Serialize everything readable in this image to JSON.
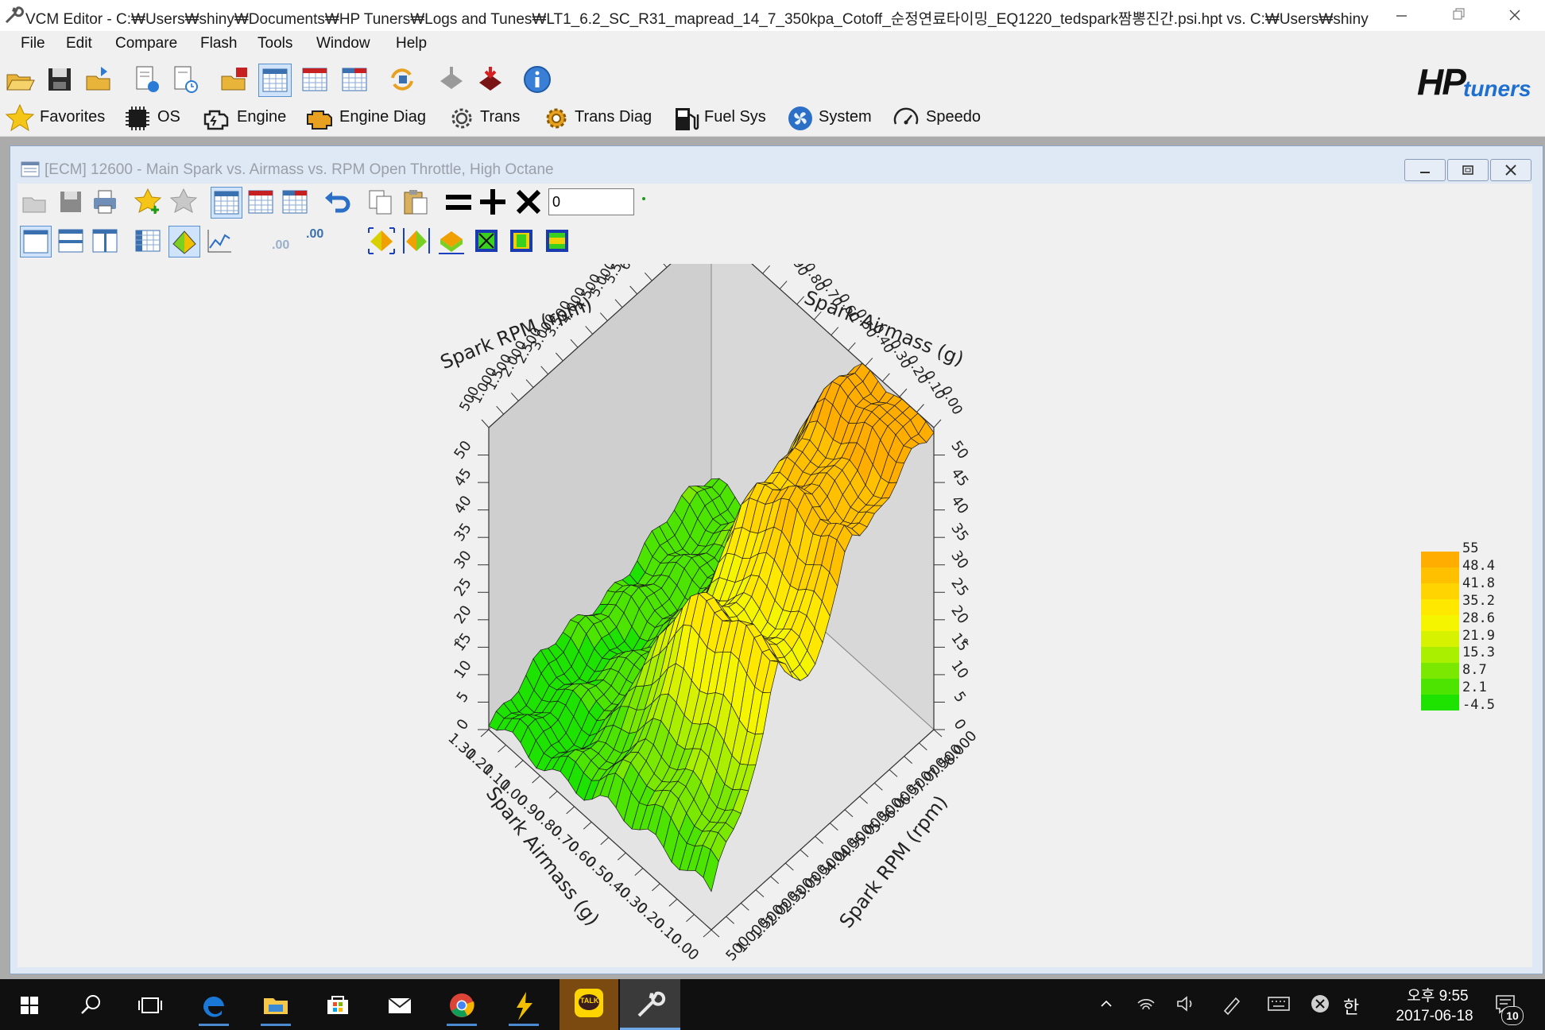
{
  "window": {
    "title": "VCM Editor - C:₩Users₩shiny₩Documents₩HP Tuners₩Logs and Tunes₩LT1_6.2_SC_R31_mapread_14_7_350kpa_Cotoff_순정연료타이밍_EQ1220_tedspark짬뽕진간.psi.hpt vs. C:₩Users₩shiny"
  },
  "menu": [
    "File",
    "Edit",
    "Compare",
    "Flash",
    "Tools",
    "Window",
    "Help"
  ],
  "brand": {
    "logo_main": "HP",
    "logo_sub": "tuners"
  },
  "nav": [
    "Favorites",
    "OS",
    "Engine",
    "Engine Diag",
    "Trans",
    "Trans Diag",
    "Fuel Sys",
    "System",
    "Speedo"
  ],
  "editor": {
    "title": "[ECM] 12600 - Main Spark vs. Airmass vs. RPM Open Throttle, High Octane",
    "value_input": "0",
    "format_buttons": {
      "less_decimals": ".00",
      "more_decimals": ".00"
    }
  },
  "chart_data": {
    "type": "surface",
    "x_axis": {
      "label": "Spark Airmass (g)",
      "ticks": [
        "0.00",
        "0.10",
        "0.20",
        "0.30",
        "0.40",
        "0.50",
        "0.60",
        "0.70",
        "0.80",
        "0.90",
        "1.00",
        "1.10",
        "1.20",
        "1.30"
      ]
    },
    "y_axis": {
      "label": "Spark RPM (rpm)",
      "ticks": [
        "500",
        "1.000",
        "1.500",
        "2.000",
        "2.500",
        "3.000",
        "3.500",
        "4.000",
        "4.500",
        "5.000",
        "5.500",
        "6.000",
        "6.500",
        "7.000",
        "7.500",
        "8.000"
      ]
    },
    "z_axis": {
      "label": "°",
      "ticks": [
        "0",
        "5",
        "10",
        "15",
        "20",
        "25",
        "30",
        "35",
        "40",
        "45",
        "50"
      ],
      "range": [
        0,
        55
      ]
    },
    "legend": {
      "values": [
        "55",
        "48.4",
        "41.8",
        "35.2",
        "28.6",
        "21.9",
        "15.3",
        "8.7",
        "2.1",
        "-4.5"
      ],
      "colors": [
        "#ffae00",
        "#ffc000",
        "#ffd400",
        "#ffe800",
        "#f5f500",
        "#d6f200",
        "#aaee00",
        "#7ae800",
        "#4ce400",
        "#1ee200"
      ]
    }
  },
  "taskbar": {
    "clock_time": "오후 9:55",
    "clock_date": "2017-06-18",
    "ime": "한",
    "notifications": "10",
    "kakao_label": "TALK"
  }
}
